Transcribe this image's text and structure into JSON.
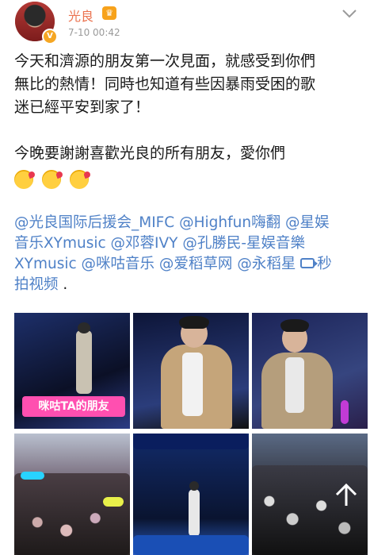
{
  "user": {
    "name": "光良",
    "time": "7-10 00:42"
  },
  "post": {
    "lines": [
      "今天和濟源的朋友第一次見面，就感受到你們",
      "無比的熱情！同時也知道有些因暴雨受困的歌",
      "迷已經平安到家了！",
      "",
      "今晚要謝謝喜歡光良的所有朋友，愛你們"
    ],
    "emojis": [
      "kiss-heart-emoji",
      "kiss-heart-emoji",
      "kiss-heart-emoji"
    ]
  },
  "mentions": {
    "line1": "@光良国际后援会_MIFC @Highfun嗨翻 @星娱",
    "line2": "音乐XYmusic @邓蓉IVY @孔勝民-星娱音樂",
    "line3": "XYmusic @咪咕音乐 @爱稻草网 @永稻星 ",
    "line3_link": "秒",
    "line4_link": "拍视频",
    "line4_tail": " ."
  },
  "photos": [
    {
      "sign": "咪咕TA的朋友"
    },
    {},
    {},
    {},
    {},
    {}
  ],
  "colors": {
    "name": "#eb7350",
    "link": "#4f81c7",
    "timestamp": "#9a9a9a"
  }
}
